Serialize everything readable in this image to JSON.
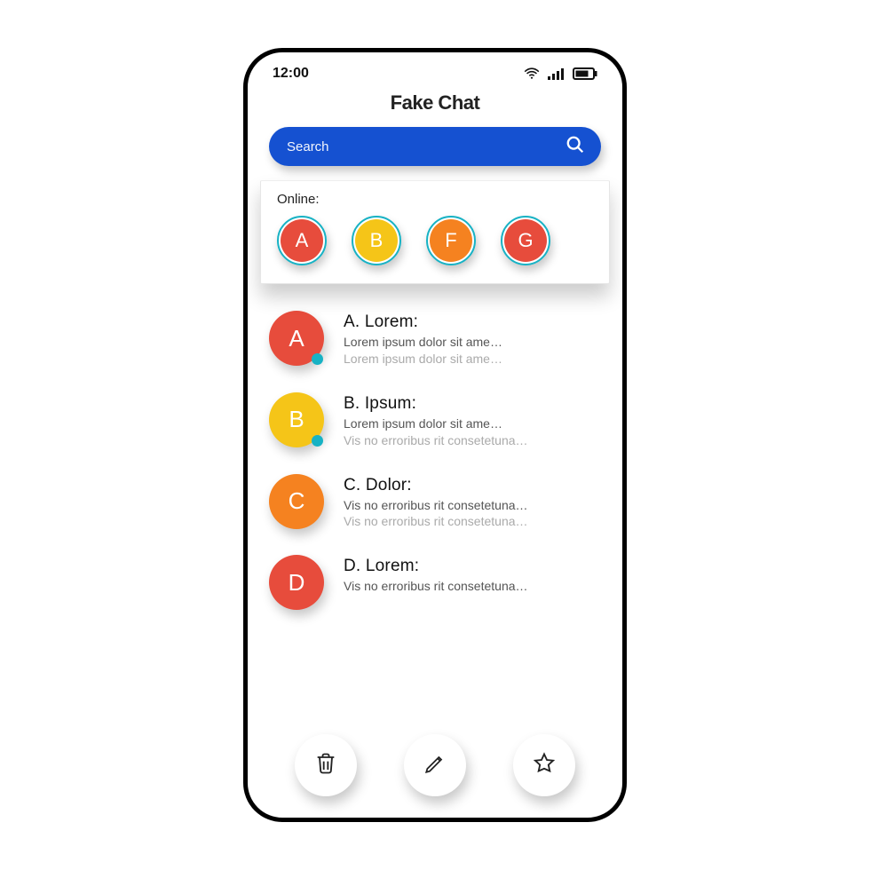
{
  "statusbar": {
    "time": "12:00"
  },
  "header": {
    "title": "Fake Chat"
  },
  "search": {
    "placeholder": "Search"
  },
  "online": {
    "label": "Online:",
    "items": [
      {
        "letter": "A",
        "color": "c-red"
      },
      {
        "letter": "B",
        "color": "c-yellow"
      },
      {
        "letter": "F",
        "color": "c-orange"
      },
      {
        "letter": "G",
        "color": "c-red"
      }
    ]
  },
  "chats": [
    {
      "letter": "A",
      "color": "c-red",
      "online": true,
      "name": "A. Lorem:",
      "line1": "Lorem ipsum dolor sit ame…",
      "line2": "Lorem ipsum dolor sit ame…"
    },
    {
      "letter": "B",
      "color": "c-yellow",
      "online": true,
      "name": "B. Ipsum:",
      "line1": "Lorem ipsum dolor sit ame…",
      "line2": "Vis no erroribus rit consetetuna…"
    },
    {
      "letter": "C",
      "color": "c-orange",
      "online": false,
      "name": "C. Dolor:",
      "line1": "Vis no erroribus rit consetetuna…",
      "line2": "Vis no erroribus rit consetetuna…"
    },
    {
      "letter": "D",
      "color": "c-red",
      "online": false,
      "name": "D. Lorem:",
      "line1": "Vis no erroribus rit consetetuna…",
      "line2": ""
    }
  ],
  "actions": {
    "trash": "trash-icon",
    "edit": "edit-icon",
    "star": "star-icon"
  }
}
